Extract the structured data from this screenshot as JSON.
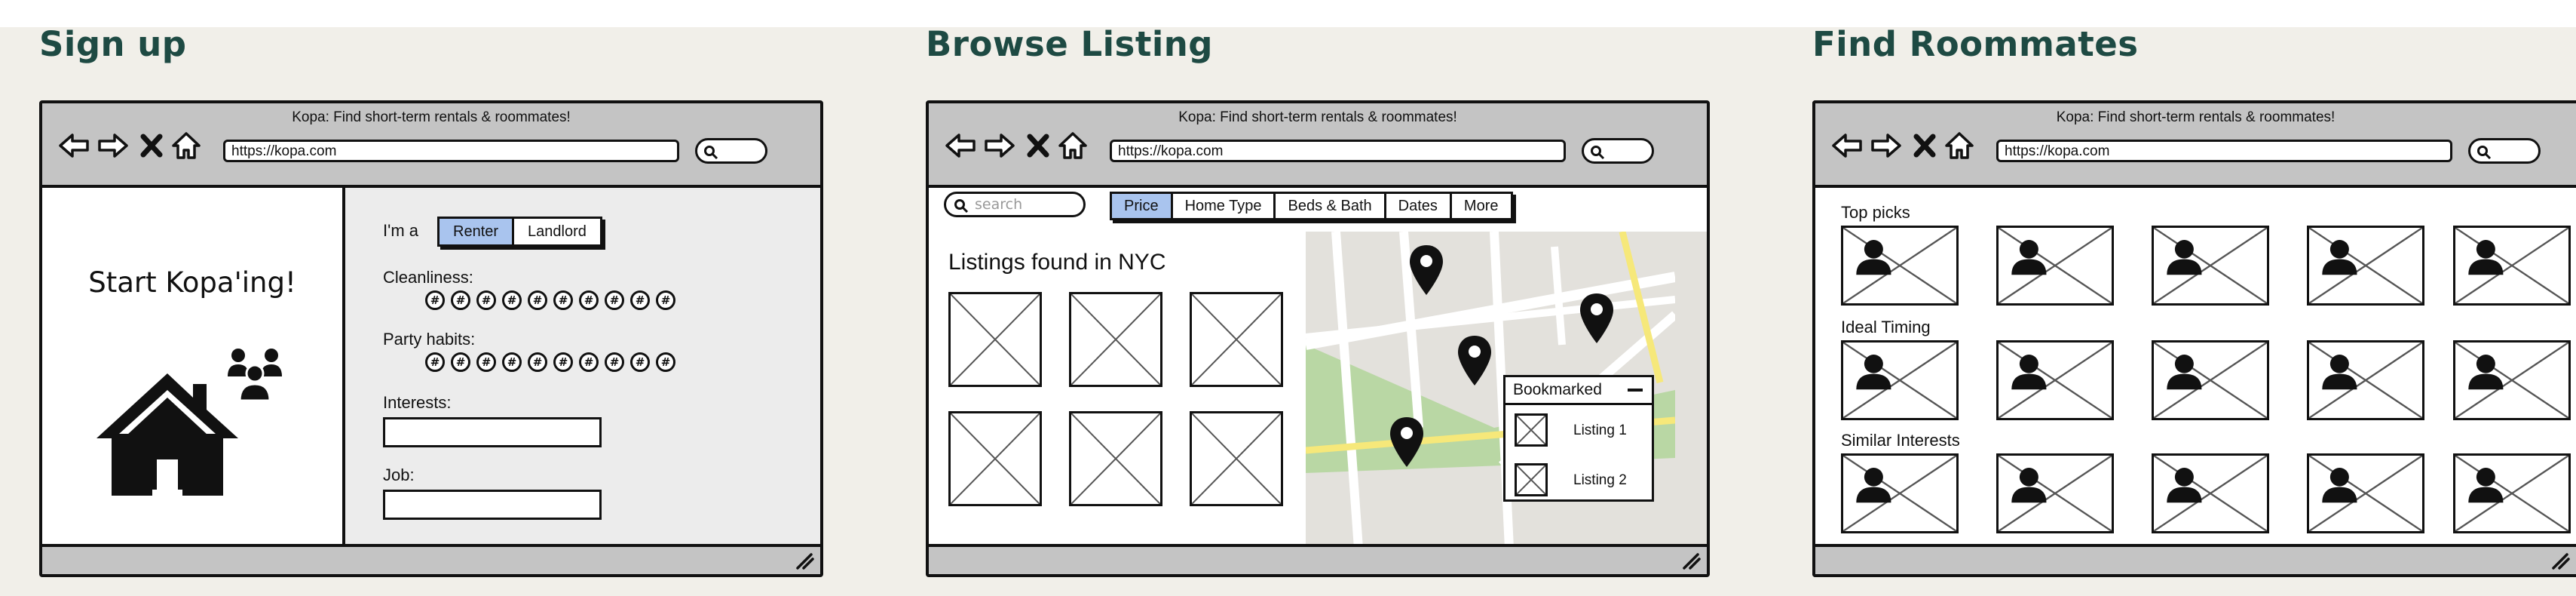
{
  "sections": {
    "signup": "Sign up",
    "browse": "Browse Listing",
    "roommates": "Find Roommates"
  },
  "browser": {
    "title": "Kopa: Find short-term rentals & roommates!",
    "url": "https://kopa.com",
    "nav_icons": [
      "back-arrow-icon",
      "forward-arrow-icon",
      "close-icon",
      "home-icon"
    ]
  },
  "signup": {
    "start_text": "Start Kopa'ing!",
    "im_a_label": "I'm a",
    "role_options": [
      "Renter",
      "Landlord"
    ],
    "selected_role": "Renter",
    "cleanliness_label": "Cleanliness:",
    "party_label": "Party habits:",
    "rating_symbol": "#",
    "rating_count": 10,
    "interests_label": "Interests:",
    "interests_value": "",
    "job_label": "Job:",
    "job_value": ""
  },
  "browse": {
    "search_placeholder": "search",
    "filters": [
      "Price",
      "Home Type",
      "Beds & Bath",
      "Dates",
      "More"
    ],
    "selected_filter": "Price",
    "listings_title": "Listings found in NYC",
    "bookmarked_title": "Bookmarked",
    "bookmarks": [
      "Listing 1",
      "Listing 2"
    ]
  },
  "roommates": {
    "rows": [
      "Top picks",
      "Ideal Timing",
      "Similar Interests"
    ]
  },
  "colors": {
    "title_text": "#1e4a43",
    "selected_tab": "#a9c4ee",
    "chrome_gray": "#c4c4c4",
    "map_park": "#b9d7a4",
    "map_road_yellow": "#f6e87a"
  }
}
